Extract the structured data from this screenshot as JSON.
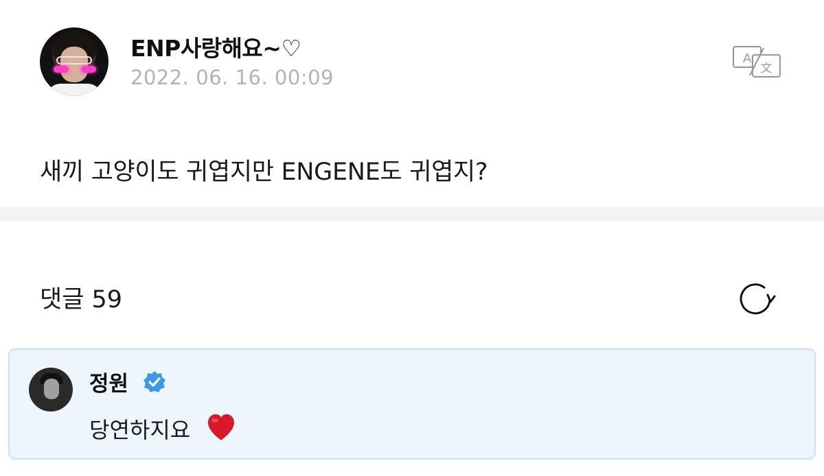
{
  "post": {
    "author_name": "ENP사랑해요~♡",
    "date": "2022. 06. 16. 00:09",
    "body": "새끼 고양이도 귀엽지만 ENGENE도 귀엽지?"
  },
  "comments": {
    "header": "댓글 59",
    "items": [
      {
        "author": "정원",
        "verified": true,
        "text": "당연하지요"
      }
    ]
  },
  "icons": {
    "translate": "translate-icon",
    "refresh": "refresh-icon",
    "verified": "verified-badge-icon",
    "heart": "red-heart-icon"
  },
  "colors": {
    "date_gray": "#b3b3b3",
    "comment_bg": "#ecf6fc",
    "comment_border": "#c3e2f3",
    "verified_blue": "#3b9ae8",
    "heart_red": "#d9182a"
  }
}
